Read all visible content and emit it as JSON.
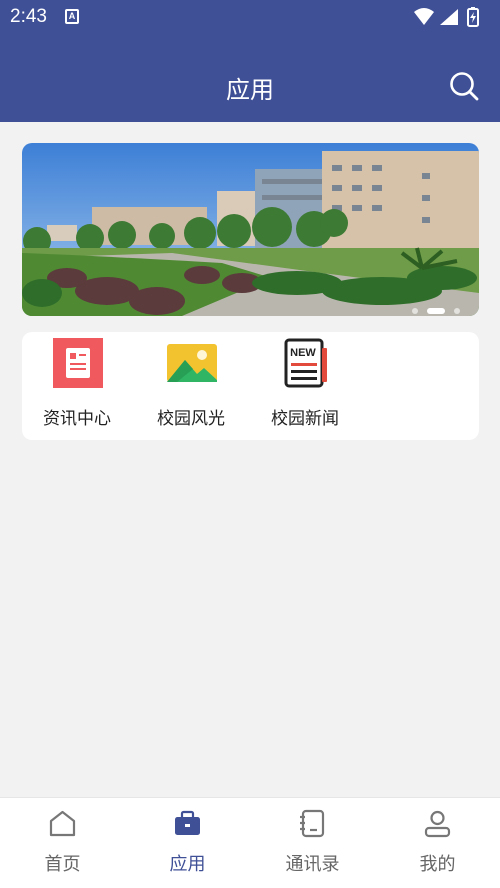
{
  "status_bar": {
    "time": "2:43",
    "left_icon": "A",
    "icons": [
      "wifi-icon",
      "signal-icon",
      "battery-charging-icon"
    ]
  },
  "header": {
    "title": "应用",
    "search_icon": "search-icon"
  },
  "banner": {
    "image": "campus-photo",
    "page_count": 3,
    "active_page": 2
  },
  "apps": [
    {
      "label": "资讯中心",
      "icon": "news-document-icon",
      "color": "#f0595d"
    },
    {
      "label": "校园风光",
      "icon": "landscape-icon",
      "color": "#f3c22f"
    },
    {
      "label": "校园新闻",
      "icon": "new-notebook-icon",
      "color": "#e24a3b",
      "icon_text": "NEW"
    }
  ],
  "bottom_nav": [
    {
      "label": "首页",
      "icon": "home-icon",
      "active": false
    },
    {
      "label": "应用",
      "icon": "briefcase-icon",
      "active": true
    },
    {
      "label": "通讯录",
      "icon": "contacts-book-icon",
      "active": false
    },
    {
      "label": "我的",
      "icon": "user-icon",
      "active": false
    }
  ],
  "colors": {
    "primary": "#3f5096",
    "background": "#f2f2f3",
    "inactive_text": "#666666"
  }
}
